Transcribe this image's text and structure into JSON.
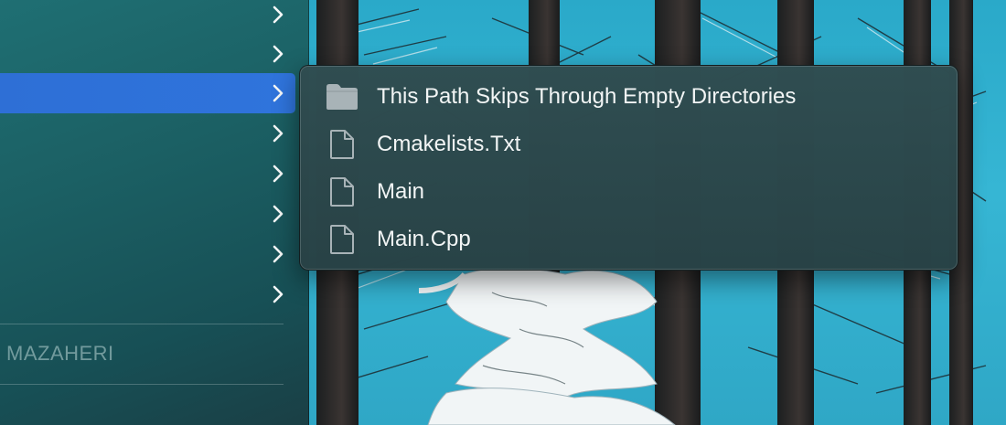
{
  "sidebar": {
    "row_count": 8,
    "selected_index": 2,
    "section_label": "MAZAHERI",
    "selection_color": "#2f72d9"
  },
  "submenu": {
    "items": [
      {
        "label": "This Path Skips Through Empty Directories",
        "icon": "folder-icon"
      },
      {
        "label": "Cmakelists.Txt",
        "icon": "document-icon"
      },
      {
        "label": "Main",
        "icon": "document-icon"
      },
      {
        "label": "Main.Cpp",
        "icon": "document-icon"
      }
    ]
  }
}
